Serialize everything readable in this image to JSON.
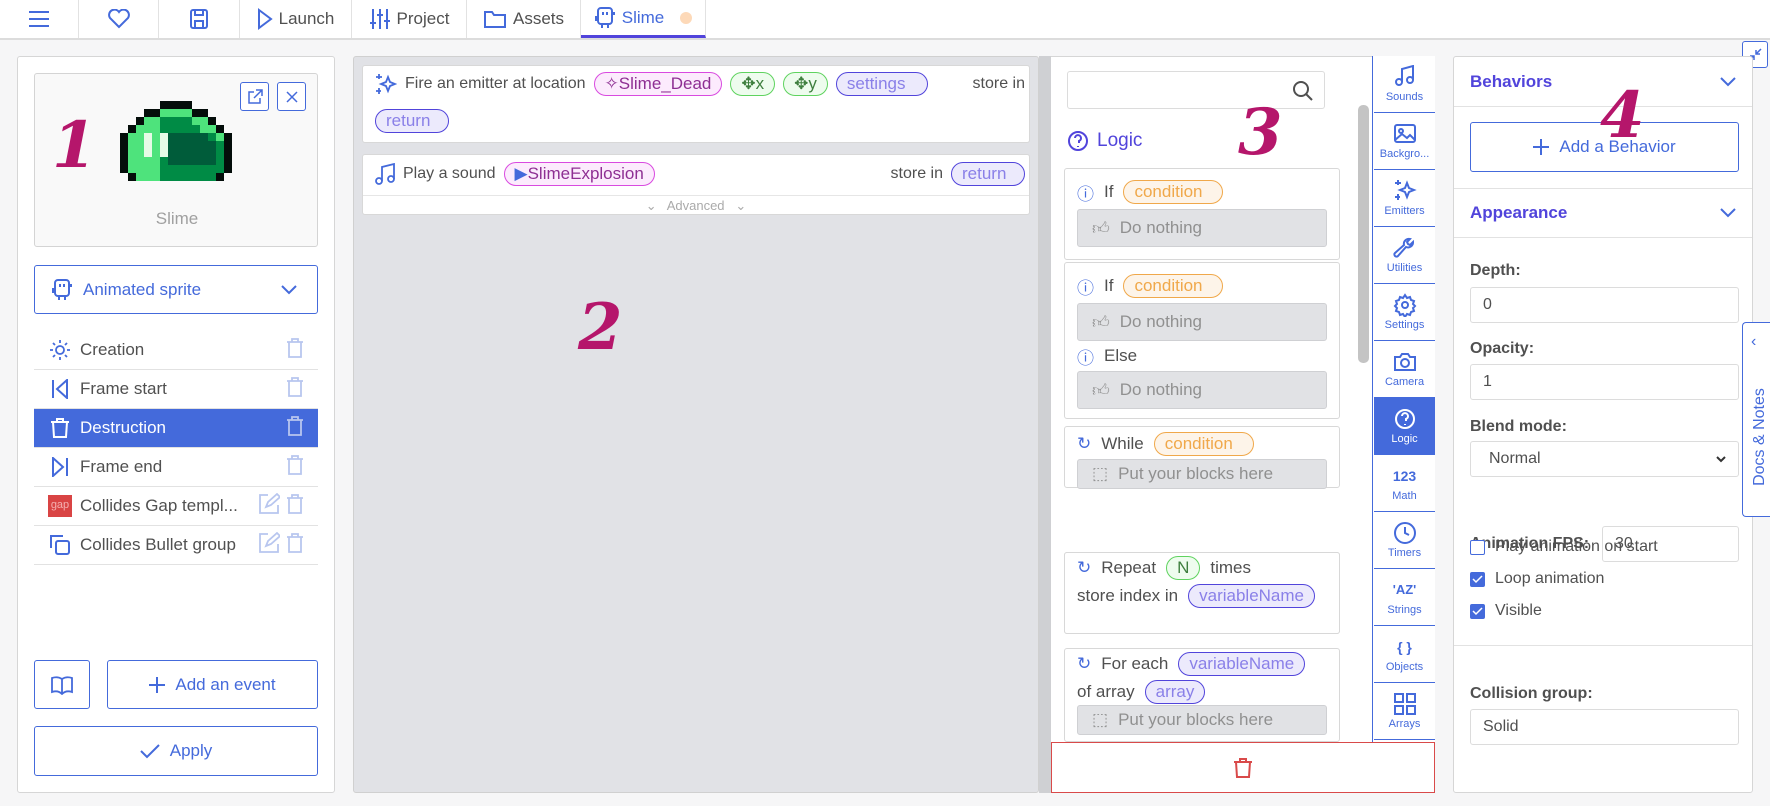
{
  "topbar": {
    "tabs": [
      {
        "icon": "menu-icon"
      },
      {
        "icon": "heart-icon"
      },
      {
        "icon": "save-icon"
      },
      {
        "label": "Launch",
        "icon": "play-icon"
      },
      {
        "label": "Project",
        "icon": "sliders-icon"
      },
      {
        "label": "Assets",
        "icon": "folder-icon"
      },
      {
        "label": "Slime",
        "icon": "robot-icon",
        "active": true,
        "unsaved": true
      }
    ]
  },
  "colors": {
    "accent": "#446adb",
    "header": "#5144db",
    "danger": "#d94a4a",
    "annotation": "#b5166b"
  },
  "annotations": [
    "1",
    "2",
    "3",
    "4"
  ],
  "left": {
    "sprite_name": "Slime",
    "template_type": "Animated sprite",
    "events": [
      {
        "label": "Creation",
        "icon": "sun-icon"
      },
      {
        "label": "Frame start",
        "icon": "frame-start-icon"
      },
      {
        "label": "Destruction",
        "icon": "trash-icon",
        "selected": true
      },
      {
        "label": "Frame end",
        "icon": "frame-end-icon"
      },
      {
        "label": "Collides Gap templ...",
        "icon": "gap-thumbnail",
        "thumb_text": "gap",
        "editable": true
      },
      {
        "label": "Collides Bullet group",
        "icon": "group-icon",
        "editable": true
      }
    ],
    "add_event": "Add an event",
    "apply": "Apply"
  },
  "code": {
    "blocks": [
      {
        "text": "Fire an emitter at location",
        "emitter": "Slime_Dead",
        "x": "x",
        "y": "y",
        "settings": "settings",
        "store": "store in",
        "ret": "return"
      },
      {
        "text": "Play a sound",
        "sound": "SlimeExplosion",
        "store": "store in",
        "ret": "return",
        "advanced": "Advanced"
      }
    ]
  },
  "library": {
    "search_placeholder": "",
    "category": "Logic",
    "if": "If",
    "condition": "condition",
    "do_nothing": "Do nothing",
    "else": "Else",
    "while": "While",
    "put_blocks": "Put your blocks here",
    "repeat": "Repeat",
    "n": "N",
    "times": "times",
    "store_index": "store index in",
    "variable": "variableName",
    "for_each": "For each",
    "of_array": "of array",
    "array": "array"
  },
  "categories": [
    {
      "label": "Sounds",
      "icon": "music-icon"
    },
    {
      "label": "Backgro...",
      "icon": "image-icon"
    },
    {
      "label": "Emitters",
      "icon": "sparkles-icon"
    },
    {
      "label": "Utilities",
      "icon": "wrench-icon"
    },
    {
      "label": "Settings",
      "icon": "gear-icon"
    },
    {
      "label": "Camera",
      "icon": "camera-icon"
    },
    {
      "label": "Logic",
      "icon": "question-icon",
      "active": true
    },
    {
      "label": "Math",
      "icon": "123"
    },
    {
      "label": "Timers",
      "icon": "clock-icon"
    },
    {
      "label": "Strings",
      "icon": "'AZ'"
    },
    {
      "label": "Objects",
      "icon": "{ }"
    },
    {
      "label": "Arrays",
      "icon": "grid-icon"
    }
  ],
  "right": {
    "behaviors": "Behaviors",
    "add_behavior": "Add a Behavior",
    "appearance": "Appearance",
    "depth_label": "Depth:",
    "depth": "0",
    "opacity_label": "Opacity:",
    "opacity": "1",
    "blend_label": "Blend mode:",
    "blend": "Normal",
    "fps_label": "Animation FPS:",
    "fps": "30",
    "checks": [
      {
        "label": "Play animation on start",
        "checked": false
      },
      {
        "label": "Loop animation",
        "checked": true
      },
      {
        "label": "Visible",
        "checked": true
      }
    ],
    "collision_label": "Collision group:",
    "collision": "Solid",
    "docs": "Docs & Notes"
  }
}
